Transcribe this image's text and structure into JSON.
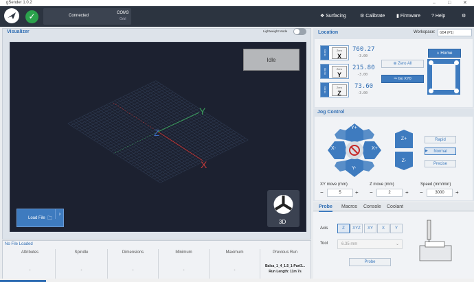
{
  "window": {
    "title": "gSender 1.0.2"
  },
  "header": {
    "connection_status": "Connected",
    "port": "COM3",
    "firmware_type": "Grbl",
    "nav": [
      {
        "label": "Surfacing",
        "icon": "surfacing-icon"
      },
      {
        "label": "Calibrate",
        "icon": "calibrate-icon"
      },
      {
        "label": "Firmware",
        "icon": "firmware-icon"
      },
      {
        "label": "Help",
        "icon": "help-icon"
      },
      {
        "label": "",
        "icon": "settings-icon"
      }
    ]
  },
  "visualizer": {
    "title": "Visualizer",
    "lightweight_label": "Lightweight Mode",
    "status": "Idle",
    "load_file_label": "Load File",
    "view_label": "3D",
    "axis_labels": {
      "x": "X",
      "y": "Y",
      "z": "Z"
    }
  },
  "file_info": {
    "status": "No File Loaded",
    "columns": [
      {
        "header": "Attributes",
        "value": "-"
      },
      {
        "header": "Spindle",
        "value": "-"
      },
      {
        "header": "Dimensions",
        "value": "-"
      },
      {
        "header": "Minimum",
        "value": "-"
      },
      {
        "header": "Maximum",
        "value": "-"
      },
      {
        "header": "Previous Run",
        "value": "Balsa_1_4_1.5_1-Part3...",
        "sub": "Run Length: 11m 7s"
      }
    ]
  },
  "location": {
    "title": "Location",
    "workspace_label": "Workspace:",
    "workspace_value": "G54 (P1)",
    "axes": [
      {
        "goto": "Go to",
        "zero": "Zero",
        "name": "X",
        "value": "760.27",
        "sub": "-3.00"
      },
      {
        "goto": "Go to",
        "zero": "Zero",
        "name": "Y",
        "value": "215.80",
        "sub": "-3.00"
      },
      {
        "goto": "Go to",
        "zero": "Zero",
        "name": "Z",
        "value": "73.60",
        "sub": "-3.00"
      }
    ],
    "zero_all_label": "Zero All",
    "goto_xy0_label": "Go XY0",
    "home_label": "Home"
  },
  "jog": {
    "title": "Jog Control",
    "buttons": {
      "y_plus": "Y+",
      "y_minus": "Y-",
      "x_plus": "X+",
      "x_minus": "X-",
      "z_plus": "Z+",
      "z_minus": "Z-"
    },
    "speeds": [
      {
        "label": "Rapid",
        "selected": false
      },
      {
        "label": "Normal",
        "selected": true
      },
      {
        "label": "Precise",
        "selected": false
      }
    ],
    "xy_label": "XY move (mm)",
    "xy_value": "5",
    "z_label": "Z move (mm)",
    "z_value": "2",
    "speed_label": "Speed (mm/min)",
    "speed_value": "3000",
    "minus": "−",
    "plus": "+"
  },
  "tabs": [
    {
      "label": "Probe",
      "active": true
    },
    {
      "label": "Macros",
      "active": false
    },
    {
      "label": "Console",
      "active": false
    },
    {
      "label": "Coolant",
      "active": false
    }
  ],
  "probe": {
    "axis_label": "Axis",
    "axes": [
      "Z",
      "XYZ",
      "XY",
      "X",
      "Y"
    ],
    "tool_label": "Tool",
    "tool_value": "6.35 mm",
    "probe_button": "Probe"
  }
}
